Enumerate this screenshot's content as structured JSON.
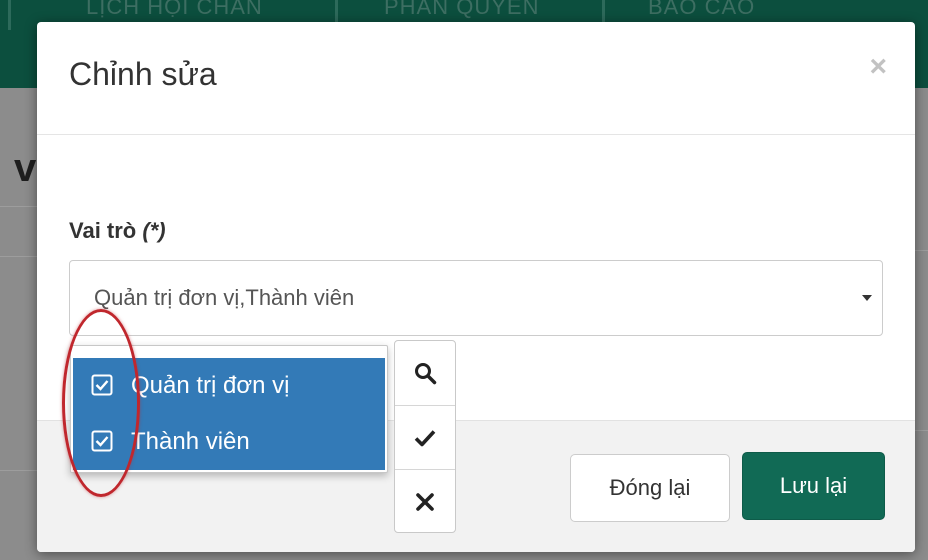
{
  "background": {
    "nav_items": [
      "LỊCH HỘI CHẨN",
      "PHÂN QUYỀN",
      "BÁO CÁO"
    ],
    "heading_fragment": "về"
  },
  "modal": {
    "title": "Chỉnh sửa",
    "close_symbol": "×"
  },
  "form": {
    "role_label": "Vai trò",
    "required_marker": "(*)",
    "role_value": "Quản trị đơn vị,Thành viên"
  },
  "dropdown": {
    "options": [
      {
        "label": "Quản trị đơn vị",
        "checked": true
      },
      {
        "label": "Thành viên",
        "checked": true
      }
    ]
  },
  "tools": {
    "icons": [
      "search-icon",
      "check-icon",
      "close-icon"
    ]
  },
  "footer": {
    "close_label": "Đóng lại",
    "save_label": "Lưu lại"
  },
  "colors": {
    "nav_bg": "#0c4f3e",
    "primary_green": "#116a55",
    "selection_blue": "#337ab7",
    "annotation_red": "#c0272d"
  }
}
